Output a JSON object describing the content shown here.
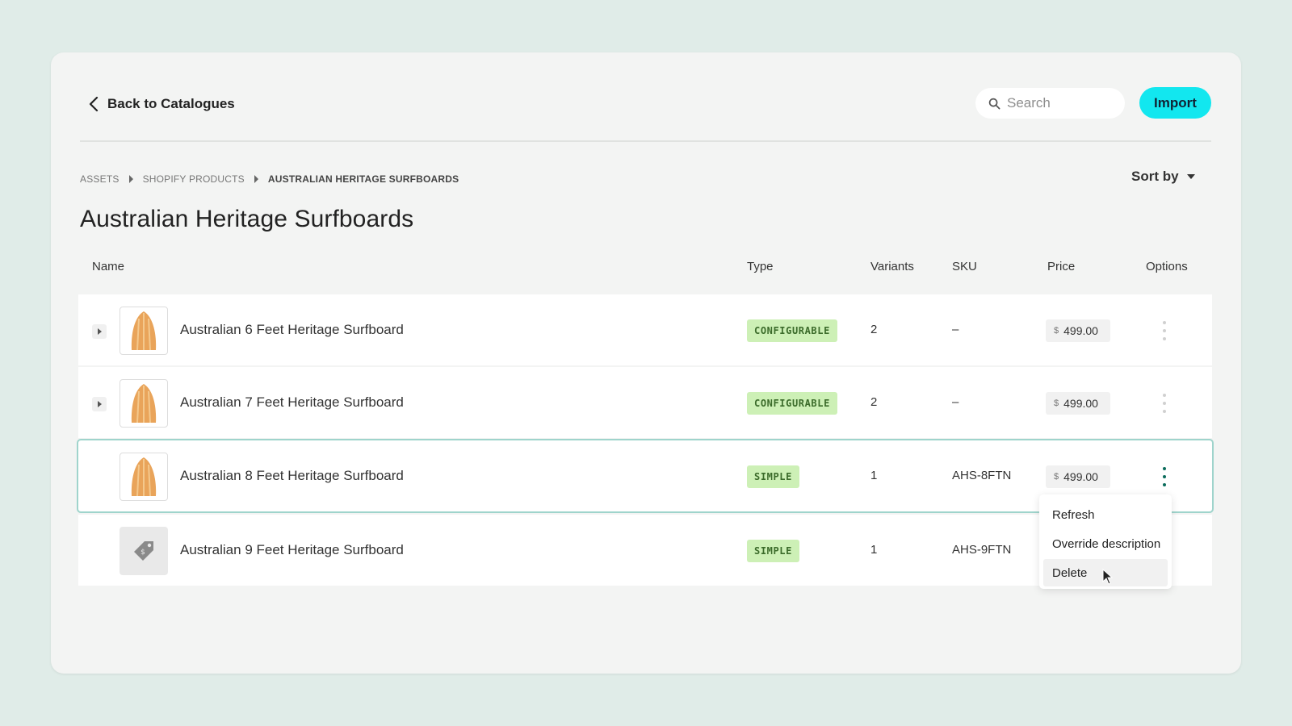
{
  "header": {
    "back_label": "Back to Catalogues",
    "search_placeholder": "Search",
    "import_label": "Import"
  },
  "breadcrumb": [
    "ASSETS",
    "SHOPIFY PRODUCTS",
    "AUSTRALIAN HERITAGE SURFBOARDS"
  ],
  "sort_label": "Sort by",
  "page_title": "Australian Heritage Surfboards",
  "columns": {
    "name": "Name",
    "type": "Type",
    "variants": "Variants",
    "sku": "SKU",
    "price": "Price",
    "options": "Options"
  },
  "rows": [
    {
      "name": "Australian 6 Feet Heritage Surfboard",
      "type": "CONFIGURABLE",
      "variants": "2",
      "sku": "–",
      "currency": "$",
      "price": "499.00",
      "thumb": "surfboard-image"
    },
    {
      "name": "Australian 7 Feet Heritage Surfboard",
      "type": "CONFIGURABLE",
      "variants": "2",
      "sku": "–",
      "currency": "$",
      "price": "499.00",
      "thumb": "surfboard-image"
    },
    {
      "name": "Australian 8 Feet Heritage Surfboard",
      "type": "SIMPLE",
      "variants": "1",
      "sku": "AHS-8FTN",
      "currency": "$",
      "price": "499.00",
      "thumb": "surfboard-image"
    },
    {
      "name": "Australian 9 Feet Heritage Surfboard",
      "type": "SIMPLE",
      "variants": "1",
      "sku": "AHS-9FTN",
      "thumb": "price-tag-icon"
    }
  ],
  "options_menu": {
    "items": [
      "Refresh",
      "Override description",
      "Delete"
    ]
  },
  "colors": {
    "accent": "#12e7ef",
    "badge_bg": "#cdf0b6",
    "badge_text": "#3b6b2a",
    "selected_outline": "#9fd4cc",
    "active_kebab": "#0b6c5c"
  }
}
